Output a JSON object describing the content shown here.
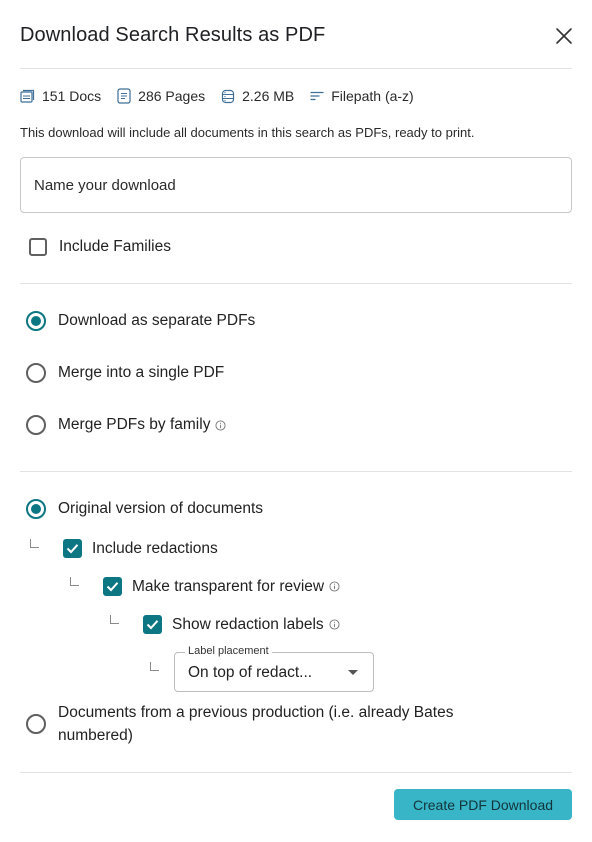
{
  "dialog": {
    "title": "Download Search Results as PDF"
  },
  "stats": {
    "docs": "151 Docs",
    "pages": "286 Pages",
    "size": "2.26 MB",
    "sort": "Filepath (a-z)"
  },
  "description": "This download will include all documents in this search as PDFs, ready to print.",
  "name_input": {
    "value": "",
    "placeholder": "Name your download"
  },
  "include_families": {
    "label": "Include Families",
    "checked": false
  },
  "pdf_mode": {
    "options": [
      {
        "label": "Download as separate PDFs",
        "selected": true
      },
      {
        "label": "Merge into a single PDF",
        "selected": false
      },
      {
        "label": "Merge PDFs by family",
        "selected": false
      }
    ]
  },
  "version": {
    "original_label": "Original version of documents",
    "original_selected": true,
    "include_redactions_label": "Include redactions",
    "include_redactions_checked": true,
    "make_transparent_label": "Make transparent for review",
    "make_transparent_checked": true,
    "show_labels_label": "Show redaction labels",
    "show_labels_checked": true,
    "label_placement": {
      "legend": "Label placement",
      "value": "On top of redact..."
    },
    "previous_production_label": "Documents from a previous production (i.e. already Bates numbered)",
    "previous_production_selected": false
  },
  "footer": {
    "create_label": "Create PDF Download"
  },
  "colors": {
    "accent": "#0d7683",
    "button": "#39b5c8"
  }
}
